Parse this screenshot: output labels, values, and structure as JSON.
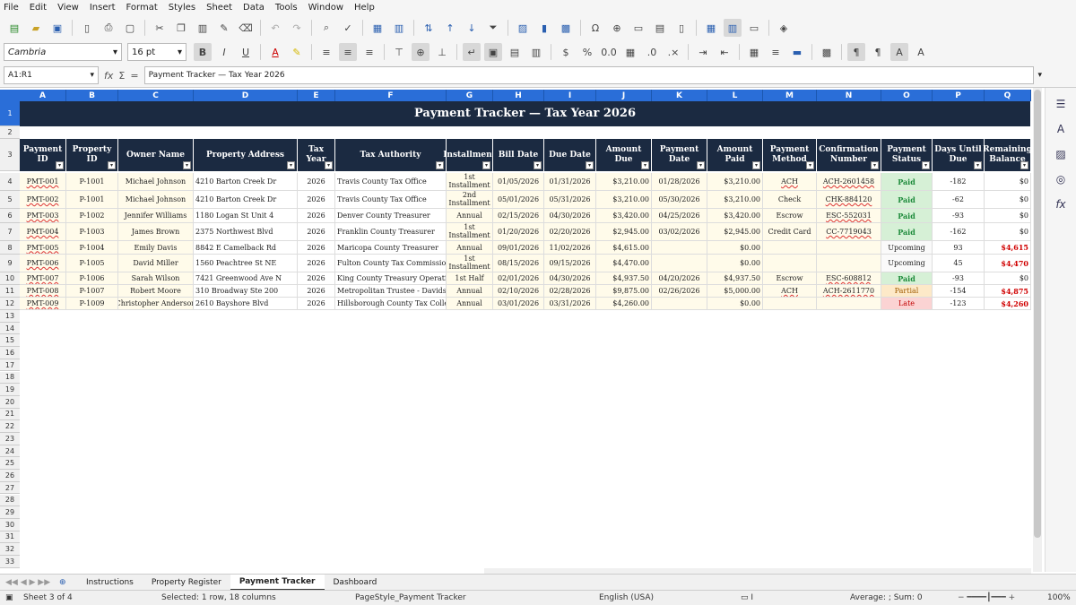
{
  "menu": [
    "File",
    "Edit",
    "View",
    "Insert",
    "Format",
    "Styles",
    "Sheet",
    "Data",
    "Tools",
    "Window",
    "Help"
  ],
  "font": {
    "name": "Cambria",
    "size": "16 pt"
  },
  "namebox": "A1:R1",
  "formula": "Payment Tracker — Tax Year 2026",
  "columns": [
    "A",
    "B",
    "C",
    "D",
    "E",
    "F",
    "G",
    "H",
    "I",
    "J",
    "K",
    "L",
    "M",
    "N",
    "O",
    "P",
    "Q"
  ],
  "title": "Payment Tracker — Tax Year 2026",
  "headers": [
    "Payment ID",
    "Property ID",
    "Owner Name",
    "Property Address",
    "Tax Year",
    "Tax Authority",
    "Installment",
    "Bill Date",
    "Due Date",
    "Amount Due",
    "Payment Date",
    "Amount Paid",
    "Payment Method",
    "Confirmation Number",
    "Payment Status",
    "Days Until Due",
    "Remaining Balance"
  ],
  "rows": [
    [
      "PMT-001",
      "P-1001",
      "Michael Johnson",
      "4210 Barton Creek Dr",
      "2026",
      "Travis County Tax Office",
      "1st Installment",
      "01/05/2026",
      "01/31/2026",
      "$3,210.00",
      "01/28/2026",
      "$3,210.00",
      "ACH",
      "ACH-2601458",
      "Paid",
      "-182",
      "$0"
    ],
    [
      "PMT-002",
      "P-1001",
      "Michael Johnson",
      "4210 Barton Creek Dr",
      "2026",
      "Travis County Tax Office",
      "2nd Installment",
      "05/01/2026",
      "05/31/2026",
      "$3,210.00",
      "05/30/2026",
      "$3,210.00",
      "Check",
      "CHK-884120",
      "Paid",
      "-62",
      "$0"
    ],
    [
      "PMT-003",
      "P-1002",
      "Jennifer Williams",
      "1180 Logan St Unit 4",
      "2026",
      "Denver County Treasurer",
      "Annual",
      "02/15/2026",
      "04/30/2026",
      "$3,420.00",
      "04/25/2026",
      "$3,420.00",
      "Escrow",
      "ESC-552031",
      "Paid",
      "-93",
      "$0"
    ],
    [
      "PMT-004",
      "P-1003",
      "James Brown",
      "2375 Northwest Blvd",
      "2026",
      "Franklin County Treasurer",
      "1st Installment",
      "01/20/2026",
      "02/20/2026",
      "$2,945.00",
      "03/02/2026",
      "$2,945.00",
      "Credit Card",
      "CC-7719043",
      "Paid",
      "-162",
      "$0"
    ],
    [
      "PMT-005",
      "P-1004",
      "Emily Davis",
      "8842 E Camelback Rd",
      "2026",
      "Maricopa County Treasurer",
      "Annual",
      "09/01/2026",
      "11/02/2026",
      "$4,615.00",
      "",
      "$0.00",
      "",
      "",
      "Upcoming",
      "93",
      "$4,615"
    ],
    [
      "PMT-006",
      "P-1005",
      "David Miller",
      "1560 Peachtree St NE",
      "2026",
      "Fulton County Tax Commissioner",
      "1st Installment",
      "08/15/2026",
      "09/15/2026",
      "$4,470.00",
      "",
      "$0.00",
      "",
      "",
      "Upcoming",
      "45",
      "$4,470"
    ],
    [
      "PMT-007",
      "P-1006",
      "Sarah Wilson",
      "7421 Greenwood Ave N",
      "2026",
      "King County Treasury Operations",
      "1st Half",
      "02/01/2026",
      "04/30/2026",
      "$4,937.50",
      "04/20/2026",
      "$4,937.50",
      "Escrow",
      "ESC-608812",
      "Paid",
      "-93",
      "$0"
    ],
    [
      "PMT-008",
      "P-1007",
      "Robert Moore",
      "310 Broadway Ste 200",
      "2026",
      "Metropolitan Trustee - Davidson",
      "Annual",
      "02/10/2026",
      "02/28/2026",
      "$9,875.00",
      "02/26/2026",
      "$5,000.00",
      "ACH",
      "ACH-2611770",
      "Partial",
      "-154",
      "$4,875"
    ],
    [
      "PMT-009",
      "P-1009",
      "Christopher Anderson",
      "2610 Bayshore Blvd",
      "2026",
      "Hillsborough County Tax Collector",
      "Annual",
      "03/01/2026",
      "03/31/2026",
      "$4,260.00",
      "",
      "$0.00",
      "",
      "",
      "Late",
      "-123",
      "$4,260"
    ]
  ],
  "tabs": [
    "Instructions",
    "Property Register",
    "Payment Tracker",
    "Dashboard"
  ],
  "active_tab": "Payment Tracker",
  "status": {
    "sheet": "Sheet 3 of 4",
    "selection": "Selected: 1 row, 18 columns",
    "pagestyle": "PageStyle_Payment Tracker",
    "lang": "English (USA)",
    "sum": "Average: ; Sum: 0",
    "zoom": "100%"
  }
}
